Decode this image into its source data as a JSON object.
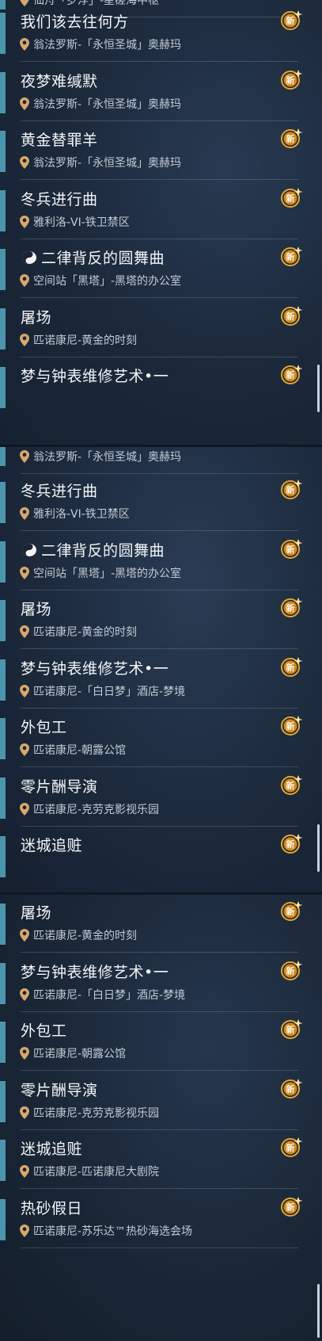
{
  "accent_color": "#4b96ad",
  "badge_color": "#e0a83a",
  "panels": [
    {
      "partial_top_location": "仙舟「罗浮」-星槎海中枢",
      "quests": [
        {
          "title": "我们该去往何方",
          "location": "翁法罗斯-「永恒圣城」奥赫玛",
          "badge": "新"
        },
        {
          "title": "夜梦难缄默",
          "location": "翁法罗斯-「永恒圣城」奥赫玛",
          "badge": "新"
        },
        {
          "title": "黄金替罪羊",
          "location": "翁法罗斯-「永恒圣城」奥赫玛",
          "badge": "新"
        },
        {
          "title": "冬兵进行曲",
          "location": "雅利洛-VI-铁卫禁区",
          "badge": "新"
        },
        {
          "title": "二律背反的圆舞曲",
          "location": "空间站「黑塔」-黑塔的办公室",
          "badge": "新",
          "icon": "yin-yang-icon"
        },
        {
          "title": "屠场",
          "location": "匹诺康尼-黄金的时刻",
          "badge": "新"
        },
        {
          "title": "梦与钟表维修艺术•一",
          "location": "",
          "badge": "新"
        }
      ]
    },
    {
      "partial_top_location": "翁法罗斯-「永恒圣城」奥赫玛",
      "quests": [
        {
          "title": "冬兵进行曲",
          "location": "雅利洛-VI-铁卫禁区",
          "badge": "新"
        },
        {
          "title": "二律背反的圆舞曲",
          "location": "空间站「黑塔」-黑塔的办公室",
          "badge": "新",
          "icon": "yin-yang-icon"
        },
        {
          "title": "屠场",
          "location": "匹诺康尼-黄金的时刻",
          "badge": "新"
        },
        {
          "title": "梦与钟表维修艺术•一",
          "location": "匹诺康尼-「白日梦」酒店-梦境",
          "badge": "新"
        },
        {
          "title": "外包工",
          "location": "匹诺康尼-朝露公馆",
          "badge": "新"
        },
        {
          "title": "零片酬导演",
          "location": "匹诺康尼-克劳克影视乐园",
          "badge": "新"
        },
        {
          "title": "迷城追赃",
          "location": "",
          "badge": "新"
        }
      ]
    },
    {
      "quests": [
        {
          "title": "屠场",
          "location": "匹诺康尼-黄金的时刻",
          "badge": "新"
        },
        {
          "title": "梦与钟表维修艺术•一",
          "location": "匹诺康尼-「白日梦」酒店-梦境",
          "badge": "新"
        },
        {
          "title": "外包工",
          "location": "匹诺康尼-朝露公馆",
          "badge": "新"
        },
        {
          "title": "零片酬导演",
          "location": "匹诺康尼-克劳克影视乐园",
          "badge": "新"
        },
        {
          "title": "迷城追赃",
          "location": "匹诺康尼-匹诺康尼大剧院",
          "badge": "新"
        },
        {
          "title": "热砂假日",
          "location": "匹诺康尼-苏乐达™热砂海选会场",
          "badge": "新"
        }
      ]
    }
  ]
}
